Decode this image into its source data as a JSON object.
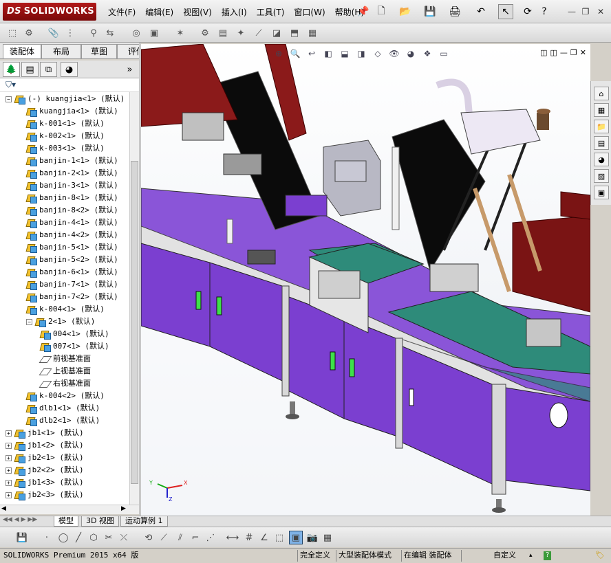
{
  "app": {
    "logo_text": "SOLIDWORKS",
    "logo_ds": "DS",
    "menus": [
      "文件(F)",
      "编辑(E)",
      "视图(V)",
      "插入(I)",
      "工具(T)",
      "窗口(W)",
      "帮助(H)"
    ],
    "search_icon": "pin-icon",
    "window_controls": [
      "minimize-icon",
      "restore-icon",
      "close-icon"
    ],
    "brand_color": "#9b1212"
  },
  "command_manager": {
    "tabs": [
      "装配体",
      "布局",
      "草图",
      "评估"
    ],
    "active_tab": "装配体"
  },
  "feature_manager": {
    "panel_tabs": [
      "feature-tree-icon",
      "property-icon",
      "config-icon",
      "appearance-icon"
    ],
    "filter_icon": "filter-icon",
    "tree": [
      {
        "label": "(-) kuangjia<1> (默认)",
        "level": 0,
        "expander": "−",
        "icon": "asm"
      },
      {
        "label": "kuangjia<1> (默认)",
        "level": 1,
        "icon": "asm"
      },
      {
        "label": "k-001<1> (默认)",
        "level": 1,
        "icon": "asm"
      },
      {
        "label": "k-002<1> (默认)",
        "level": 1,
        "icon": "asm"
      },
      {
        "label": "k-003<1> (默认)",
        "level": 1,
        "icon": "asm"
      },
      {
        "label": "banjin-1<1> (默认)",
        "level": 1,
        "icon": "asm"
      },
      {
        "label": "banjin-2<1> (默认)",
        "level": 1,
        "icon": "asm"
      },
      {
        "label": "banjin-3<1> (默认)",
        "level": 1,
        "icon": "asm"
      },
      {
        "label": "banjin-8<1> (默认)",
        "level": 1,
        "icon": "asm"
      },
      {
        "label": "banjin-8<2> (默认)",
        "level": 1,
        "icon": "asm"
      },
      {
        "label": "banjin-4<1> (默认)",
        "level": 1,
        "icon": "asm"
      },
      {
        "label": "banjin-4<2> (默认)",
        "level": 1,
        "icon": "asm"
      },
      {
        "label": "banjin-5<1> (默认)",
        "level": 1,
        "icon": "asm"
      },
      {
        "label": "banjin-5<2> (默认)",
        "level": 1,
        "icon": "asm"
      },
      {
        "label": "banjin-6<1> (默认)",
        "level": 1,
        "icon": "asm"
      },
      {
        "label": "banjin-7<1> (默认)",
        "level": 1,
        "icon": "asm"
      },
      {
        "label": "banjin-7<2> (默认)",
        "level": 1,
        "icon": "asm"
      },
      {
        "label": "k-004<1> (默认)",
        "level": 1,
        "icon": "asm"
      },
      {
        "label": "2<1> (默认)",
        "level": 1,
        "expander": "−",
        "icon": "asm"
      },
      {
        "label": "004<1> (默认)",
        "level": 2,
        "icon": "asm"
      },
      {
        "label": "007<1> (默认)",
        "level": 2,
        "icon": "asm"
      },
      {
        "label": "前视基准面",
        "level": 2,
        "icon": "plane"
      },
      {
        "label": "上视基准面",
        "level": 2,
        "icon": "plane"
      },
      {
        "label": "右视基准面",
        "level": 2,
        "icon": "plane"
      },
      {
        "label": "k-004<2> (默认)",
        "level": 1,
        "icon": "asm"
      },
      {
        "label": "dlb1<1> (默认)",
        "level": 1,
        "icon": "asm"
      },
      {
        "label": "dlb2<1> (默认)",
        "level": 1,
        "icon": "asm"
      },
      {
        "label": "jb1<1> (默认)",
        "level": 0,
        "expander": "+",
        "icon": "asm"
      },
      {
        "label": "jb1<2> (默认)",
        "level": 0,
        "expander": "+",
        "icon": "asm"
      },
      {
        "label": "jb2<1> (默认)",
        "level": 0,
        "expander": "+",
        "icon": "asm"
      },
      {
        "label": "jb2<2> (默认)",
        "level": 0,
        "expander": "+",
        "icon": "asm"
      },
      {
        "label": "jb1<3> (默认)",
        "level": 0,
        "expander": "+",
        "icon": "asm"
      },
      {
        "label": "jb2<3> (默认)",
        "level": 0,
        "expander": "+",
        "icon": "asm"
      }
    ]
  },
  "viewport": {
    "triad_labels": {
      "x": "X",
      "y": "Y",
      "z": "Z"
    },
    "machine_colors": {
      "cabinet": "#7b3fd0",
      "plate": "#2e8b7a",
      "frame": "#cfcfcf",
      "panel": "#111111",
      "rail": "#8b1a1a"
    }
  },
  "bottom_tabs": [
    "模型",
    "3D 视图",
    "运动算例 1"
  ],
  "bottom_tabs_active": "模型",
  "status": {
    "product": "SOLIDWORKS Premium 2015 x64 版",
    "definition": "完全定义",
    "mode": "大型装配体模式",
    "editing": "在编辑 装配体",
    "units": "自定义",
    "units_arrow": "▴",
    "help": "?"
  }
}
